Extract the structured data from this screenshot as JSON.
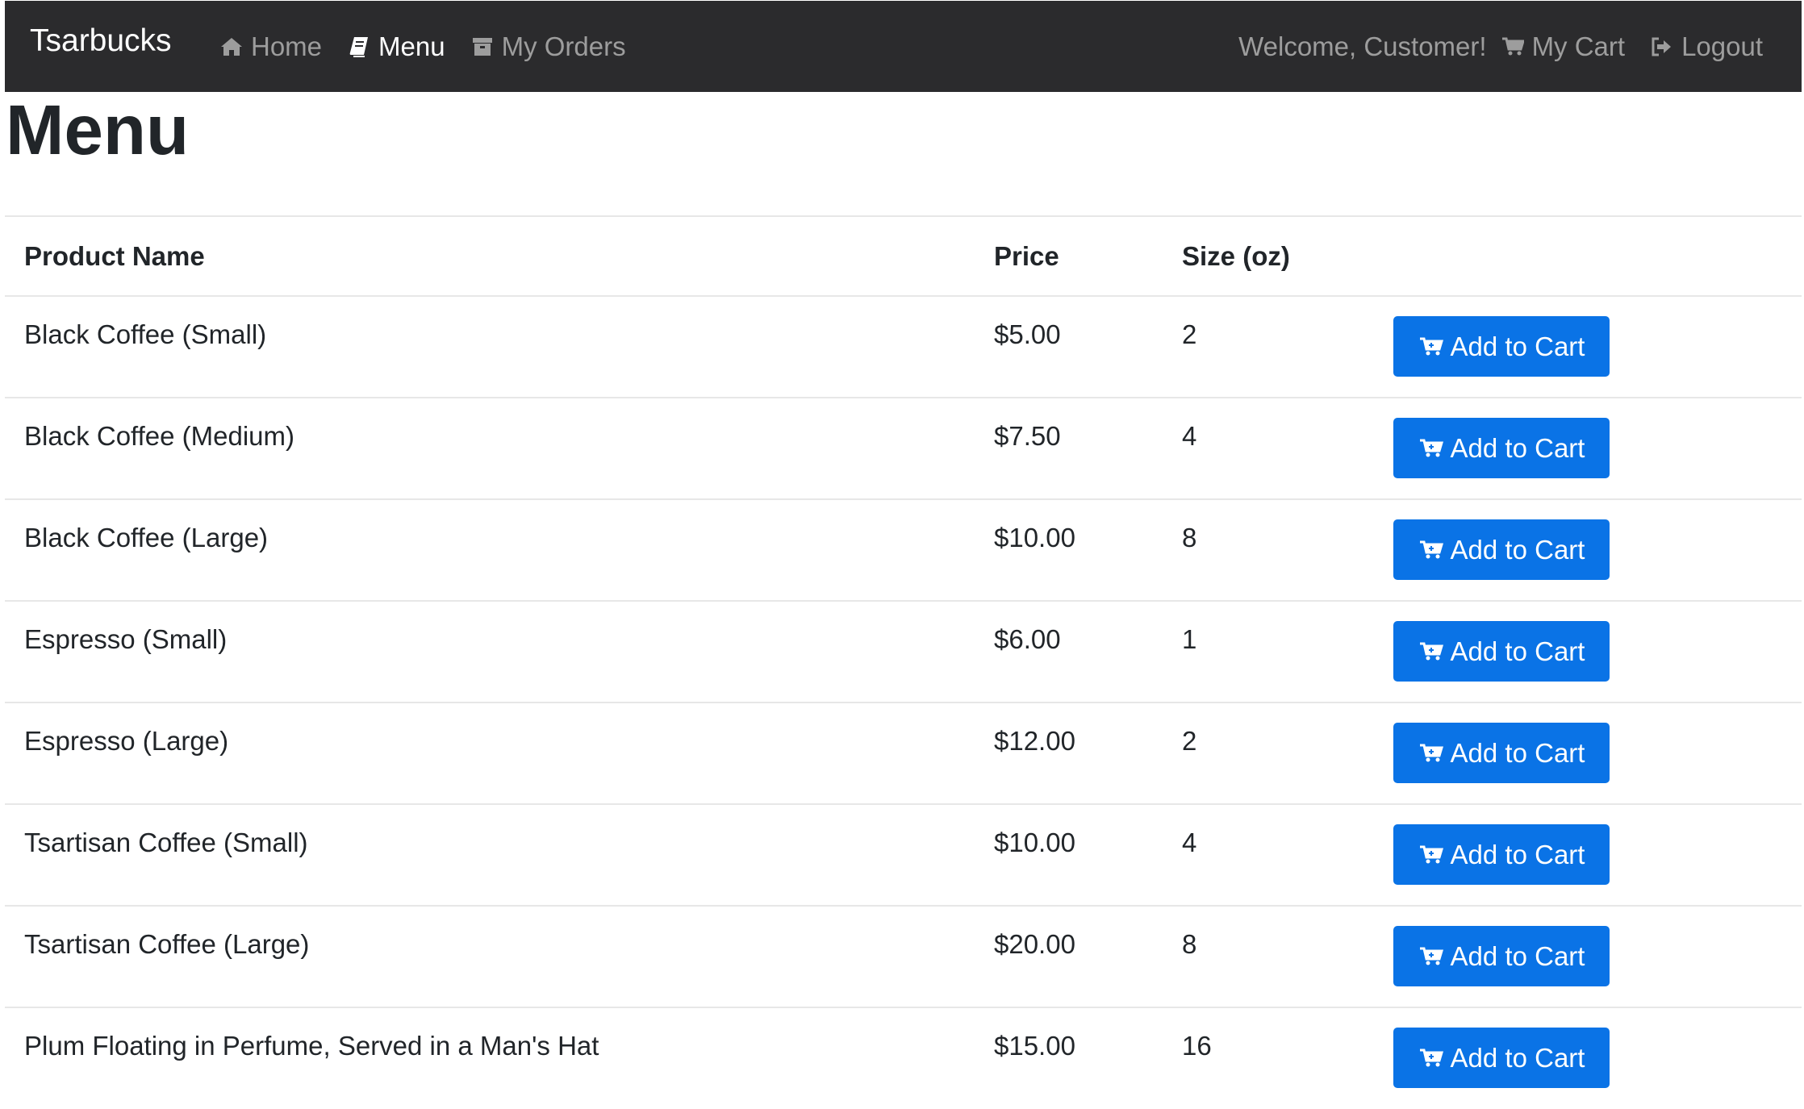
{
  "navbar": {
    "brand": "Tsarbucks",
    "left_items": [
      {
        "label": "Home",
        "icon": "home-icon"
      },
      {
        "label": "Menu",
        "icon": "book-icon",
        "active": true
      },
      {
        "label": "My Orders",
        "icon": "archive-icon"
      }
    ],
    "welcome": "Welcome, Customer!",
    "cart_label": "My Cart",
    "logout_label": "Logout"
  },
  "page": {
    "title": "Menu"
  },
  "table": {
    "headers": [
      "Product Name",
      "Price",
      "Size (oz)"
    ],
    "add_label": "Add to Cart",
    "rows": [
      {
        "name": "Black Coffee (Small)",
        "price": "$5.00",
        "size": "2"
      },
      {
        "name": "Black Coffee (Medium)",
        "price": "$7.50",
        "size": "4"
      },
      {
        "name": "Black Coffee (Large)",
        "price": "$10.00",
        "size": "8"
      },
      {
        "name": "Espresso (Small)",
        "price": "$6.00",
        "size": "1"
      },
      {
        "name": "Espresso (Large)",
        "price": "$12.00",
        "size": "2"
      },
      {
        "name": "Tsartisan Coffee (Small)",
        "price": "$10.00",
        "size": "4"
      },
      {
        "name": "Tsartisan Coffee (Large)",
        "price": "$20.00",
        "size": "8"
      },
      {
        "name": "Plum Floating in Perfume, Served in a Man's Hat",
        "price": "$15.00",
        "size": "16"
      }
    ]
  },
  "colors": {
    "navbar_bg": "#2b2b2d",
    "nav_text": "#9d9d9d",
    "nav_active": "#ffffff",
    "button_bg": "#0a73e6",
    "divider": "#e7e7e7"
  }
}
